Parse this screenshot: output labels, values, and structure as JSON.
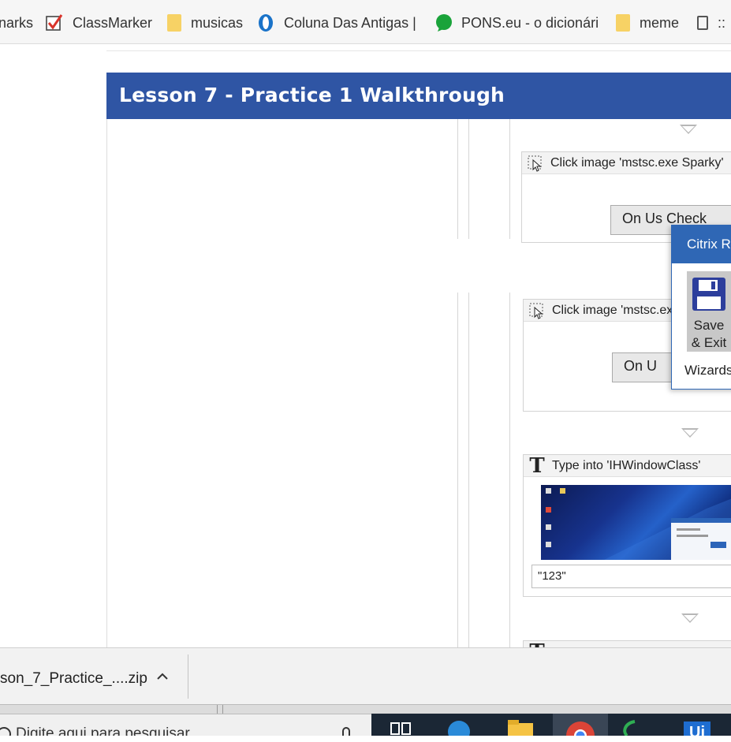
{
  "bookmarks_bar": {
    "items": [
      {
        "label": "narks",
        "icon": "bookmarks-icon"
      },
      {
        "label": "ClassMarker",
        "icon": "classmarker-check-icon"
      },
      {
        "label": "musicas",
        "icon": "folder-icon"
      },
      {
        "label": "Coluna Das Antigas |",
        "icon": "opera-icon"
      },
      {
        "label": "PONS.eu - o dicionári",
        "icon": "pons-icon"
      },
      {
        "label": "meme",
        "icon": "folder-icon"
      },
      {
        "label": "::",
        "icon": "page-icon"
      }
    ]
  },
  "header": {
    "title": "Lesson 7 - Practice 1 Walkthrough",
    "color": "#2f55a4"
  },
  "workflow": {
    "cards": [
      {
        "title": "Click image 'mstsc.exe Sparky'",
        "button_preview": "On Us Check"
      },
      {
        "title": "Click image 'mstsc.exe",
        "button_preview": "On U"
      },
      {
        "title": "Type into 'IHWindowClass'",
        "value": "\"123\""
      }
    ]
  },
  "popup": {
    "title": "Citrix Re",
    "save_label_line1": "Save",
    "save_label_line2": "& Exit",
    "group_label": "Wizards",
    "accent": "#2f67b5"
  },
  "download_bar": {
    "file_name": "son_7_Practice_....zip"
  },
  "taskbar": {
    "search_placeholder": "Digite aqui para pesquisar",
    "icons": [
      "task-view-icon",
      "edge-icon",
      "file-explorer-icon",
      "chrome-icon",
      "green-app-icon",
      "uipath-icon"
    ],
    "uipath_label": "Ui"
  }
}
